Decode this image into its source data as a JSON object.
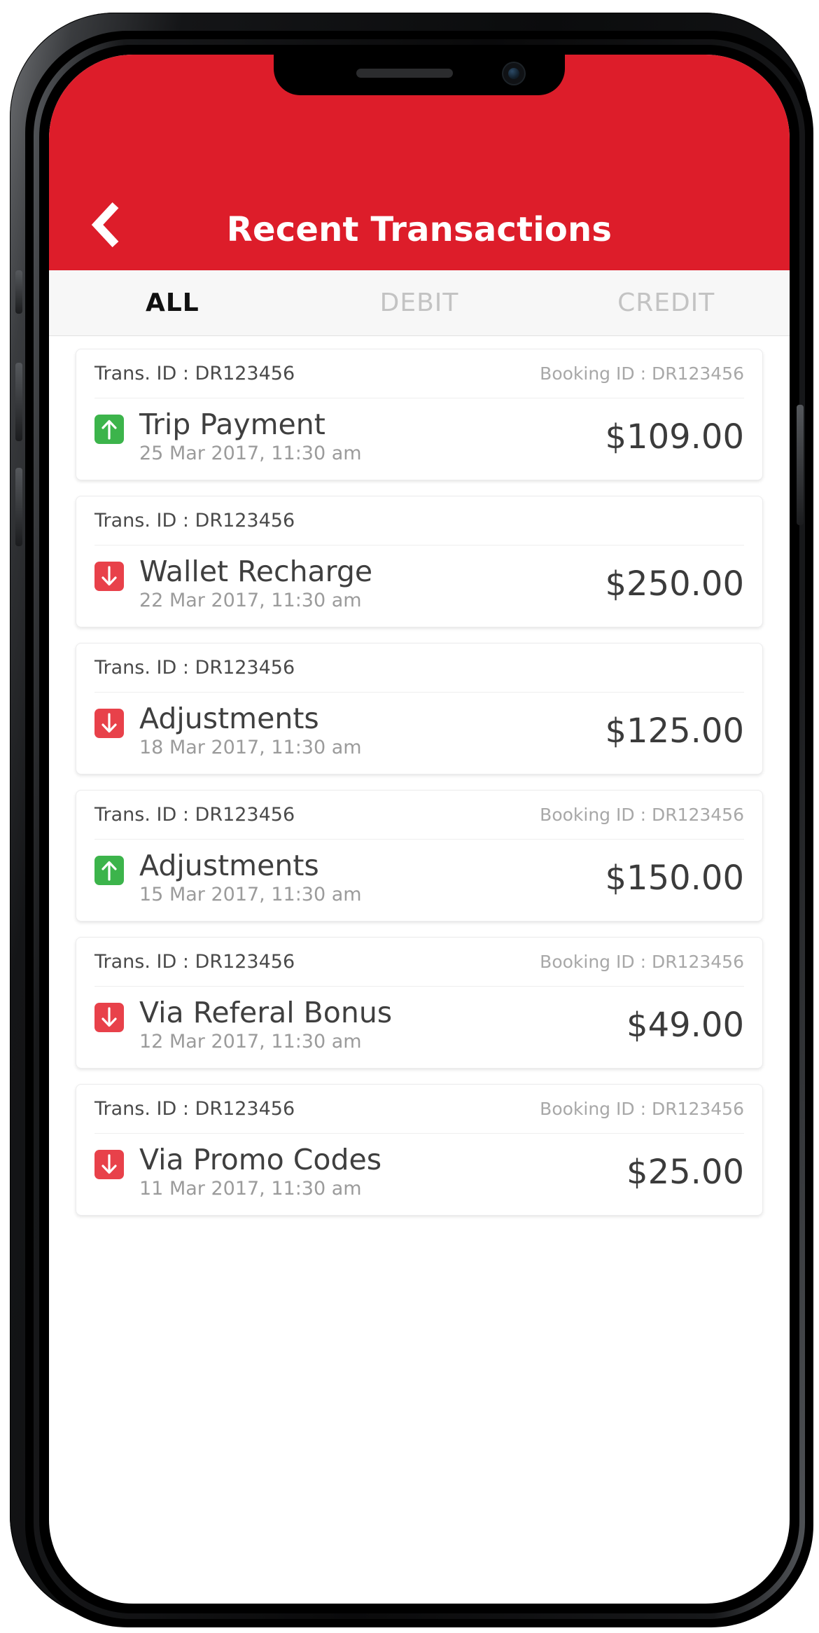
{
  "device": {
    "notch": {
      "speaker_icon": "speaker-grille",
      "camera_icon": "front-camera"
    },
    "buttons": [
      "silent-switch",
      "volume-up",
      "volume-down",
      "power"
    ]
  },
  "header": {
    "title": "Recent Transactions",
    "back_icon": "chevron-left-icon",
    "background_color": "#dd1d2a",
    "text_color": "#ffffff"
  },
  "tabs": [
    {
      "label": "ALL",
      "active": true
    },
    {
      "label": "DEBIT",
      "active": false
    },
    {
      "label": "CREDIT",
      "active": false
    }
  ],
  "labels": {
    "trans_id_prefix": "Trans. ID : ",
    "booking_id_prefix": "Booking ID : "
  },
  "colors": {
    "brand_red": "#dd1d2a",
    "credit_green": "#3cb44b",
    "debit_red": "#e8414a",
    "tab_active": "#111111",
    "tab_inactive": "#c3c3c3"
  },
  "transactions": [
    {
      "trans_id": "Trans. ID : DR123456",
      "booking_id": "Booking ID : DR123456",
      "has_booking_id": true,
      "title": "Trip Payment",
      "date": "25 Mar 2017, 11:30 am",
      "amount": "$109.00",
      "direction": "credit",
      "icon": "arrow-up-icon"
    },
    {
      "trans_id": "Trans. ID : DR123456",
      "booking_id": "",
      "has_booking_id": false,
      "title": "Wallet Recharge",
      "date": "22 Mar 2017, 11:30 am",
      "amount": "$250.00",
      "direction": "debit",
      "icon": "arrow-down-icon"
    },
    {
      "trans_id": "Trans. ID : DR123456",
      "booking_id": "",
      "has_booking_id": false,
      "title": "Adjustments",
      "date": "18 Mar 2017, 11:30 am",
      "amount": "$125.00",
      "direction": "debit",
      "icon": "arrow-down-icon"
    },
    {
      "trans_id": "Trans. ID : DR123456",
      "booking_id": "Booking ID : DR123456",
      "has_booking_id": true,
      "title": "Adjustments",
      "date": "15 Mar 2017, 11:30 am",
      "amount": "$150.00",
      "direction": "credit",
      "icon": "arrow-up-icon"
    },
    {
      "trans_id": "Trans. ID : DR123456",
      "booking_id": "Booking ID : DR123456",
      "has_booking_id": true,
      "title": "Via Referal Bonus",
      "date": "12 Mar 2017, 11:30 am",
      "amount": "$49.00",
      "direction": "debit",
      "icon": "arrow-down-icon"
    },
    {
      "trans_id": "Trans. ID : DR123456",
      "booking_id": "Booking ID : DR123456",
      "has_booking_id": true,
      "title": "Via Promo Codes",
      "date": "11 Mar 2017, 11:30 am",
      "amount": "$25.00",
      "direction": "debit",
      "icon": "arrow-down-icon"
    }
  ]
}
